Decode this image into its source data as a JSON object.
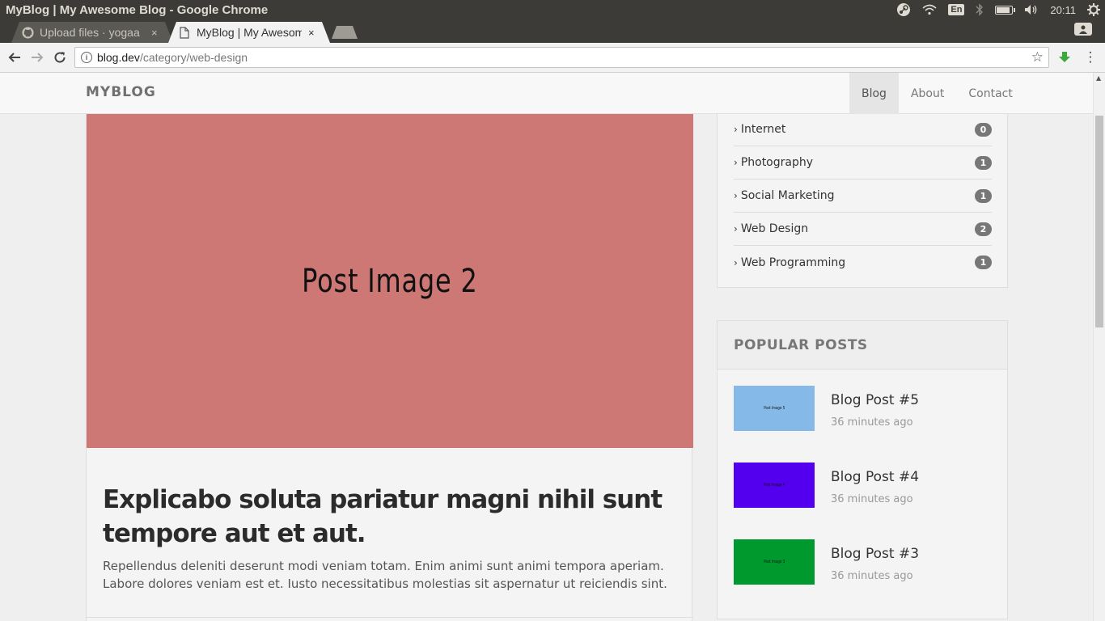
{
  "os": {
    "window_title": "MyBlog | My Awesome Blog - Google Chrome",
    "keyboard_layout": "En",
    "clock": "20:11",
    "battery_level": 0.8
  },
  "browser": {
    "tabs": [
      {
        "label": "Upload files · yogaa",
        "icon": "github-icon",
        "active": false
      },
      {
        "label": "MyBlog | My Awesom",
        "icon": "page-icon",
        "active": true
      }
    ],
    "tab_close_glyph": "×",
    "url_host": "blog.dev",
    "url_path": "/category/web-design"
  },
  "site": {
    "brand": "MYBLOG",
    "nav": [
      "Blog",
      "About",
      "Contact"
    ],
    "active_nav": "Blog"
  },
  "post": {
    "image_label": "Post Image 2",
    "image_color": "#cd7875",
    "title": "Explicabo soluta pariatur magni nihil sunt tempore aut et aut.",
    "excerpt": "Repellendus deleniti deserunt modi veniam totam. Enim animi sunt animi tempora aperiam. Labore dolores veniam est et. Iusto necessitatibus molestias sit aspernatur ut reiciendis sint."
  },
  "categories": [
    {
      "name": "Internet",
      "count": "0"
    },
    {
      "name": "Photography",
      "count": "1"
    },
    {
      "name": "Social Marketing",
      "count": "1"
    },
    {
      "name": "Web Design",
      "count": "2"
    },
    {
      "name": "Web Programming",
      "count": "1"
    }
  ],
  "popular": {
    "heading": "POPULAR POSTS",
    "posts": [
      {
        "title": "Blog Post #5",
        "time": "36 minutes ago",
        "thumb_label": "Post Image 5",
        "color": "#85b9e8"
      },
      {
        "title": "Blog Post #4",
        "time": "36 minutes ago",
        "thumb_label": "Post Image 4",
        "color": "#5200ee"
      },
      {
        "title": "Blog Post #3",
        "time": "36 minutes ago",
        "thumb_label": "Post Image 3",
        "color": "#00992e"
      }
    ]
  }
}
